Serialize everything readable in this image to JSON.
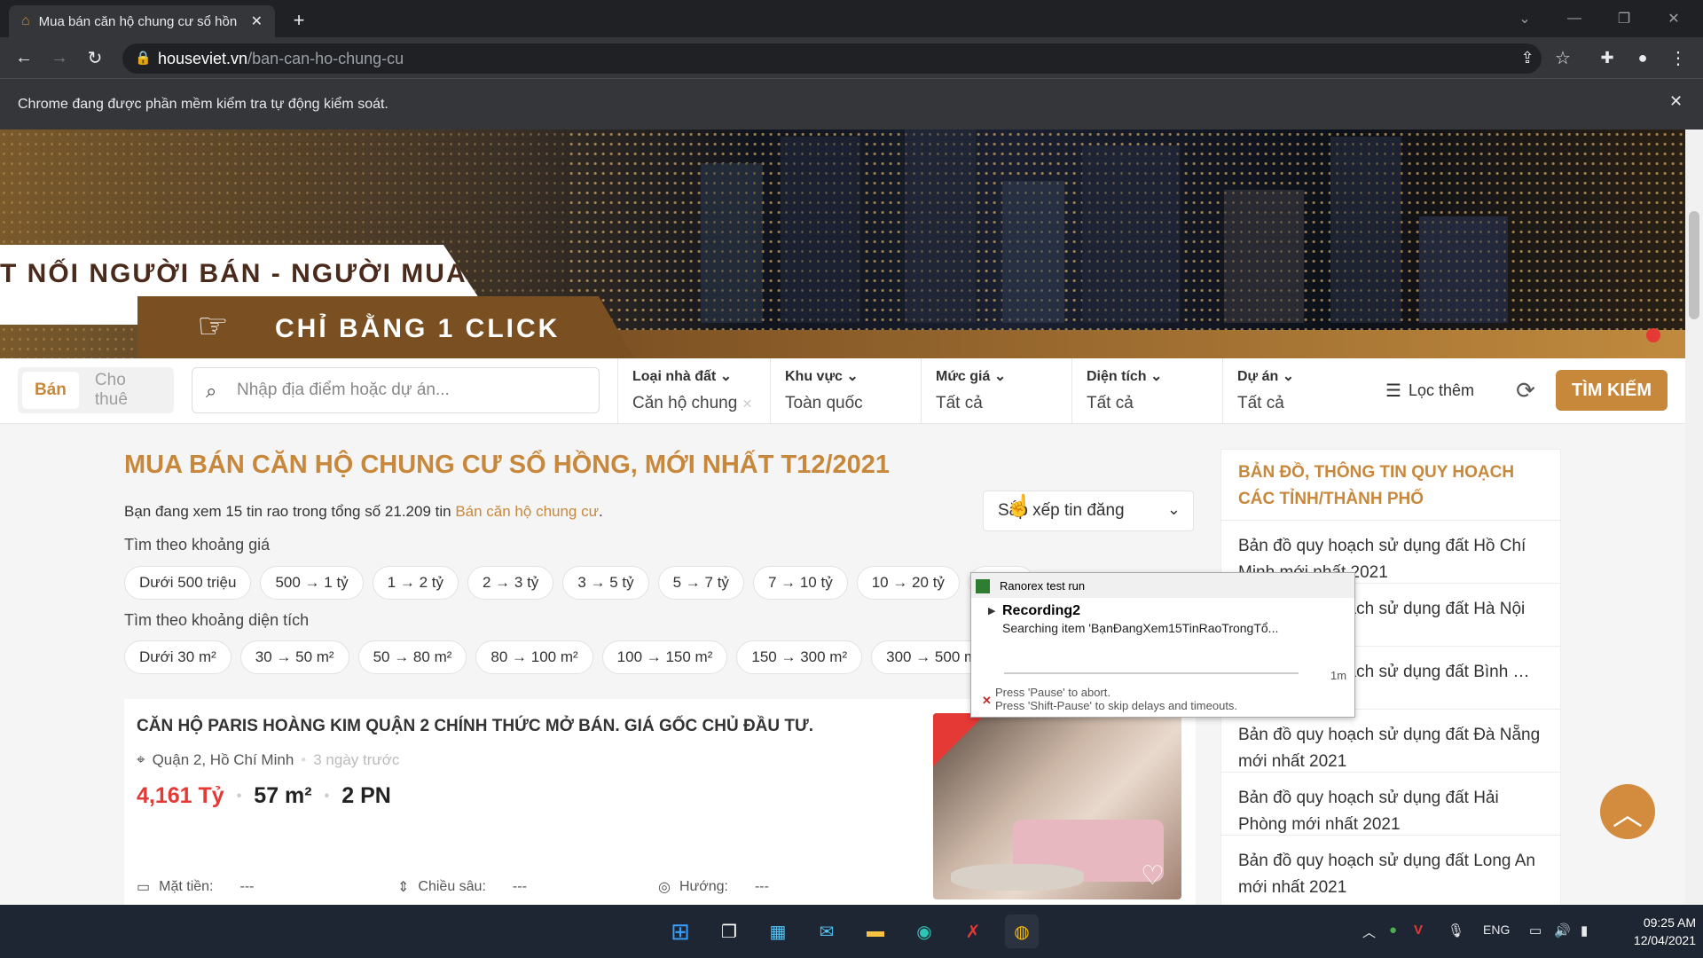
{
  "browser": {
    "tab_title": "Mua bán căn hộ chung cư sổ hồn",
    "url_host": "houseviet.vn",
    "url_path": "/ban-can-ho-chung-cu",
    "infobar_text": "Chrome đang được phần mềm kiểm tra tự động kiểm soát."
  },
  "banner": {
    "slogan_line1": "T NỐI NGƯỜI BÁN - NGƯỜI MUA",
    "slogan_line2": "CHỈ BẰNG 1 CLICK"
  },
  "search": {
    "mode_sell": "Bán",
    "mode_rent": "Cho thuê",
    "placeholder": "Nhập địa điểm hoặc dự án...",
    "filters": [
      {
        "label": "Loại nhà đất",
        "value": "Căn hộ chung"
      },
      {
        "label": "Khu vực",
        "value": "Toàn quốc"
      },
      {
        "label": "Mức giá",
        "value": "Tất cả"
      },
      {
        "label": "Diện tích",
        "value": "Tất cả"
      },
      {
        "label": "Dự án",
        "value": "Tất cả"
      }
    ],
    "more_filters": "Lọc thêm",
    "submit": "TÌM KIẾM"
  },
  "main": {
    "title": "MUA BÁN CĂN HỘ CHUNG CƯ SỔ HỒNG, MỚI NHẤT T12/2021",
    "summary_prefix": "Bạn đang xem 15 tin rao trong tổng số 21.209 tin",
    "summary_link": "Bán căn hộ chung cư",
    "summary_suffix": ".",
    "sort_label": "Sắp xếp tin đăng",
    "price_section": "Tìm theo khoảng giá",
    "price_chips": [
      "Dưới 500 triệu",
      "500 → 1 tỷ",
      "1 → 2 tỷ",
      "2 → 3 tỷ",
      "3 → 5 tỷ",
      "5 → 7 tỷ",
      "7 → 10 tỷ",
      "10 → 20 tỷ",
      "20 →"
    ],
    "area_section": "Tìm theo khoảng diện tích",
    "area_chips": [
      "Dưới 30 m²",
      "30 → 50 m²",
      "50 → 80 m²",
      "80 → 100 m²",
      "100 → 150 m²",
      "150 → 300 m²",
      "300 → 500 m²"
    ]
  },
  "listing": {
    "title": "CĂN HỘ PARIS HOÀNG KIM QUẬN 2 CHÍNH THỨC MỞ BÁN. GIÁ GỐC CHỦ ĐẦU TƯ.",
    "location": "Quận 2, Hồ Chí Minh",
    "posted": "3 ngày trước",
    "price": "4,161 Tỷ",
    "area": "57 m²",
    "bedrooms": "2 PN",
    "front_label": "Mặt tiền:",
    "front_value": "---",
    "depth_label": "Chiều sâu:",
    "depth_value": "---",
    "direction_label": "Hướng:",
    "direction_value": "---"
  },
  "sidebar": {
    "heading": "BẢN ĐỒ, THÔNG TIN QUY HOẠCH CÁC TỈNH/THÀNH PHỐ",
    "items": [
      "Bản đồ quy hoạch sử dụng đất Hồ Chí Minh mới nhất 2021",
      "Bản đồ quy hoạch sử dụng đất Hà Nội",
      "Bản đồ quy hoạch sử dụng đất Bình … 2021",
      "Bản đồ quy hoạch sử dụng đất Đà Nẵng mới nhất 2021",
      "Bản đồ quy hoạch sử dụng đất Hải Phòng mới nhất 2021",
      "Bản đồ quy hoạch sử dụng đất Long An mới nhất 2021"
    ]
  },
  "ranorex": {
    "title": "Ranorex test run",
    "recording": "Recording2",
    "searching": "Searching item 'BạnĐangXem15TinRaoTrongTổ...",
    "timer": "1m",
    "hint1": "Press 'Pause' to abort.",
    "hint2": "Press 'Shift-Pause' to skip delays and timeouts."
  },
  "taskbar": {
    "language": "ENG",
    "time": "09:25 AM",
    "date": "12/04/2021"
  },
  "colors": {
    "accent": "#c8883c",
    "price": "#e53935",
    "chrome_dark": "#202124",
    "taskbar": "#1f2633"
  },
  "icons": [
    "search-icon",
    "chevron-down-icon",
    "filter-icon",
    "refresh-icon",
    "location-pin-icon",
    "heart-icon",
    "arrow-up-icon",
    "lock-icon",
    "star-icon",
    "extension-icon",
    "profile-icon"
  ]
}
